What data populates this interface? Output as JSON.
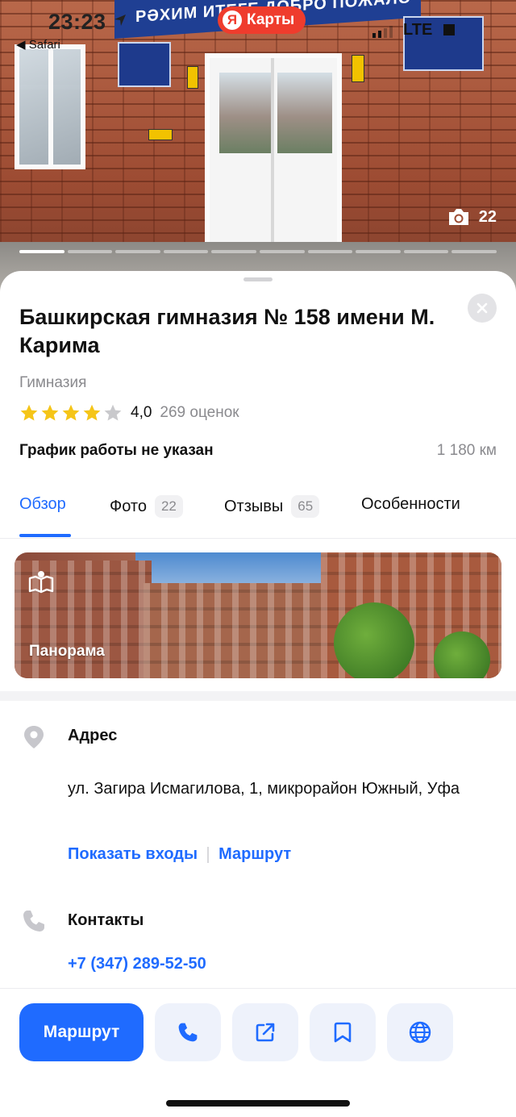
{
  "status_bar": {
    "time": "23:23",
    "back_app": "◀ Safari",
    "network": "LTE"
  },
  "hero": {
    "logo_mark": "Я",
    "logo_text": "Карты",
    "sign_text": "РӘХИМ ИТЕГЕ   ДОБРО ПОЖАЛО",
    "photo_count": "22",
    "progress_total": 10,
    "progress_current": 1
  },
  "place": {
    "title": "Башкирская гимназия № 158 имени М. Карима",
    "category": "Гимназия",
    "rating_value": "4,0",
    "rating_stars": 4,
    "rating_count": "269 оценок",
    "hours": "График работы не указан",
    "distance": "1 180 км"
  },
  "tabs": [
    {
      "label": "Обзор",
      "badge": ""
    },
    {
      "label": "Фото",
      "badge": "22"
    },
    {
      "label": "Отзывы",
      "badge": "65"
    },
    {
      "label": "Особенности",
      "badge": ""
    }
  ],
  "panorama": {
    "label": "Панорама"
  },
  "address": {
    "title": "Адрес",
    "text": "ул. Загира Исмагилова, 1, микрорайон Южный, Уфа",
    "link_entrances": "Показать входы",
    "link_route": "Маршрут"
  },
  "contacts": {
    "title": "Контакты",
    "phone": "+7 (347) 289-52-50"
  },
  "actions": {
    "route_label": "Маршрут",
    "icons": [
      "phone-icon",
      "share-icon",
      "bookmark-icon",
      "globe-icon"
    ]
  },
  "colors": {
    "accent": "#1f6bff",
    "logo_red": "#ef3c2d",
    "star": "#f5c518",
    "star_empty": "#c9c9cc",
    "muted_text": "#8a8a8e"
  }
}
